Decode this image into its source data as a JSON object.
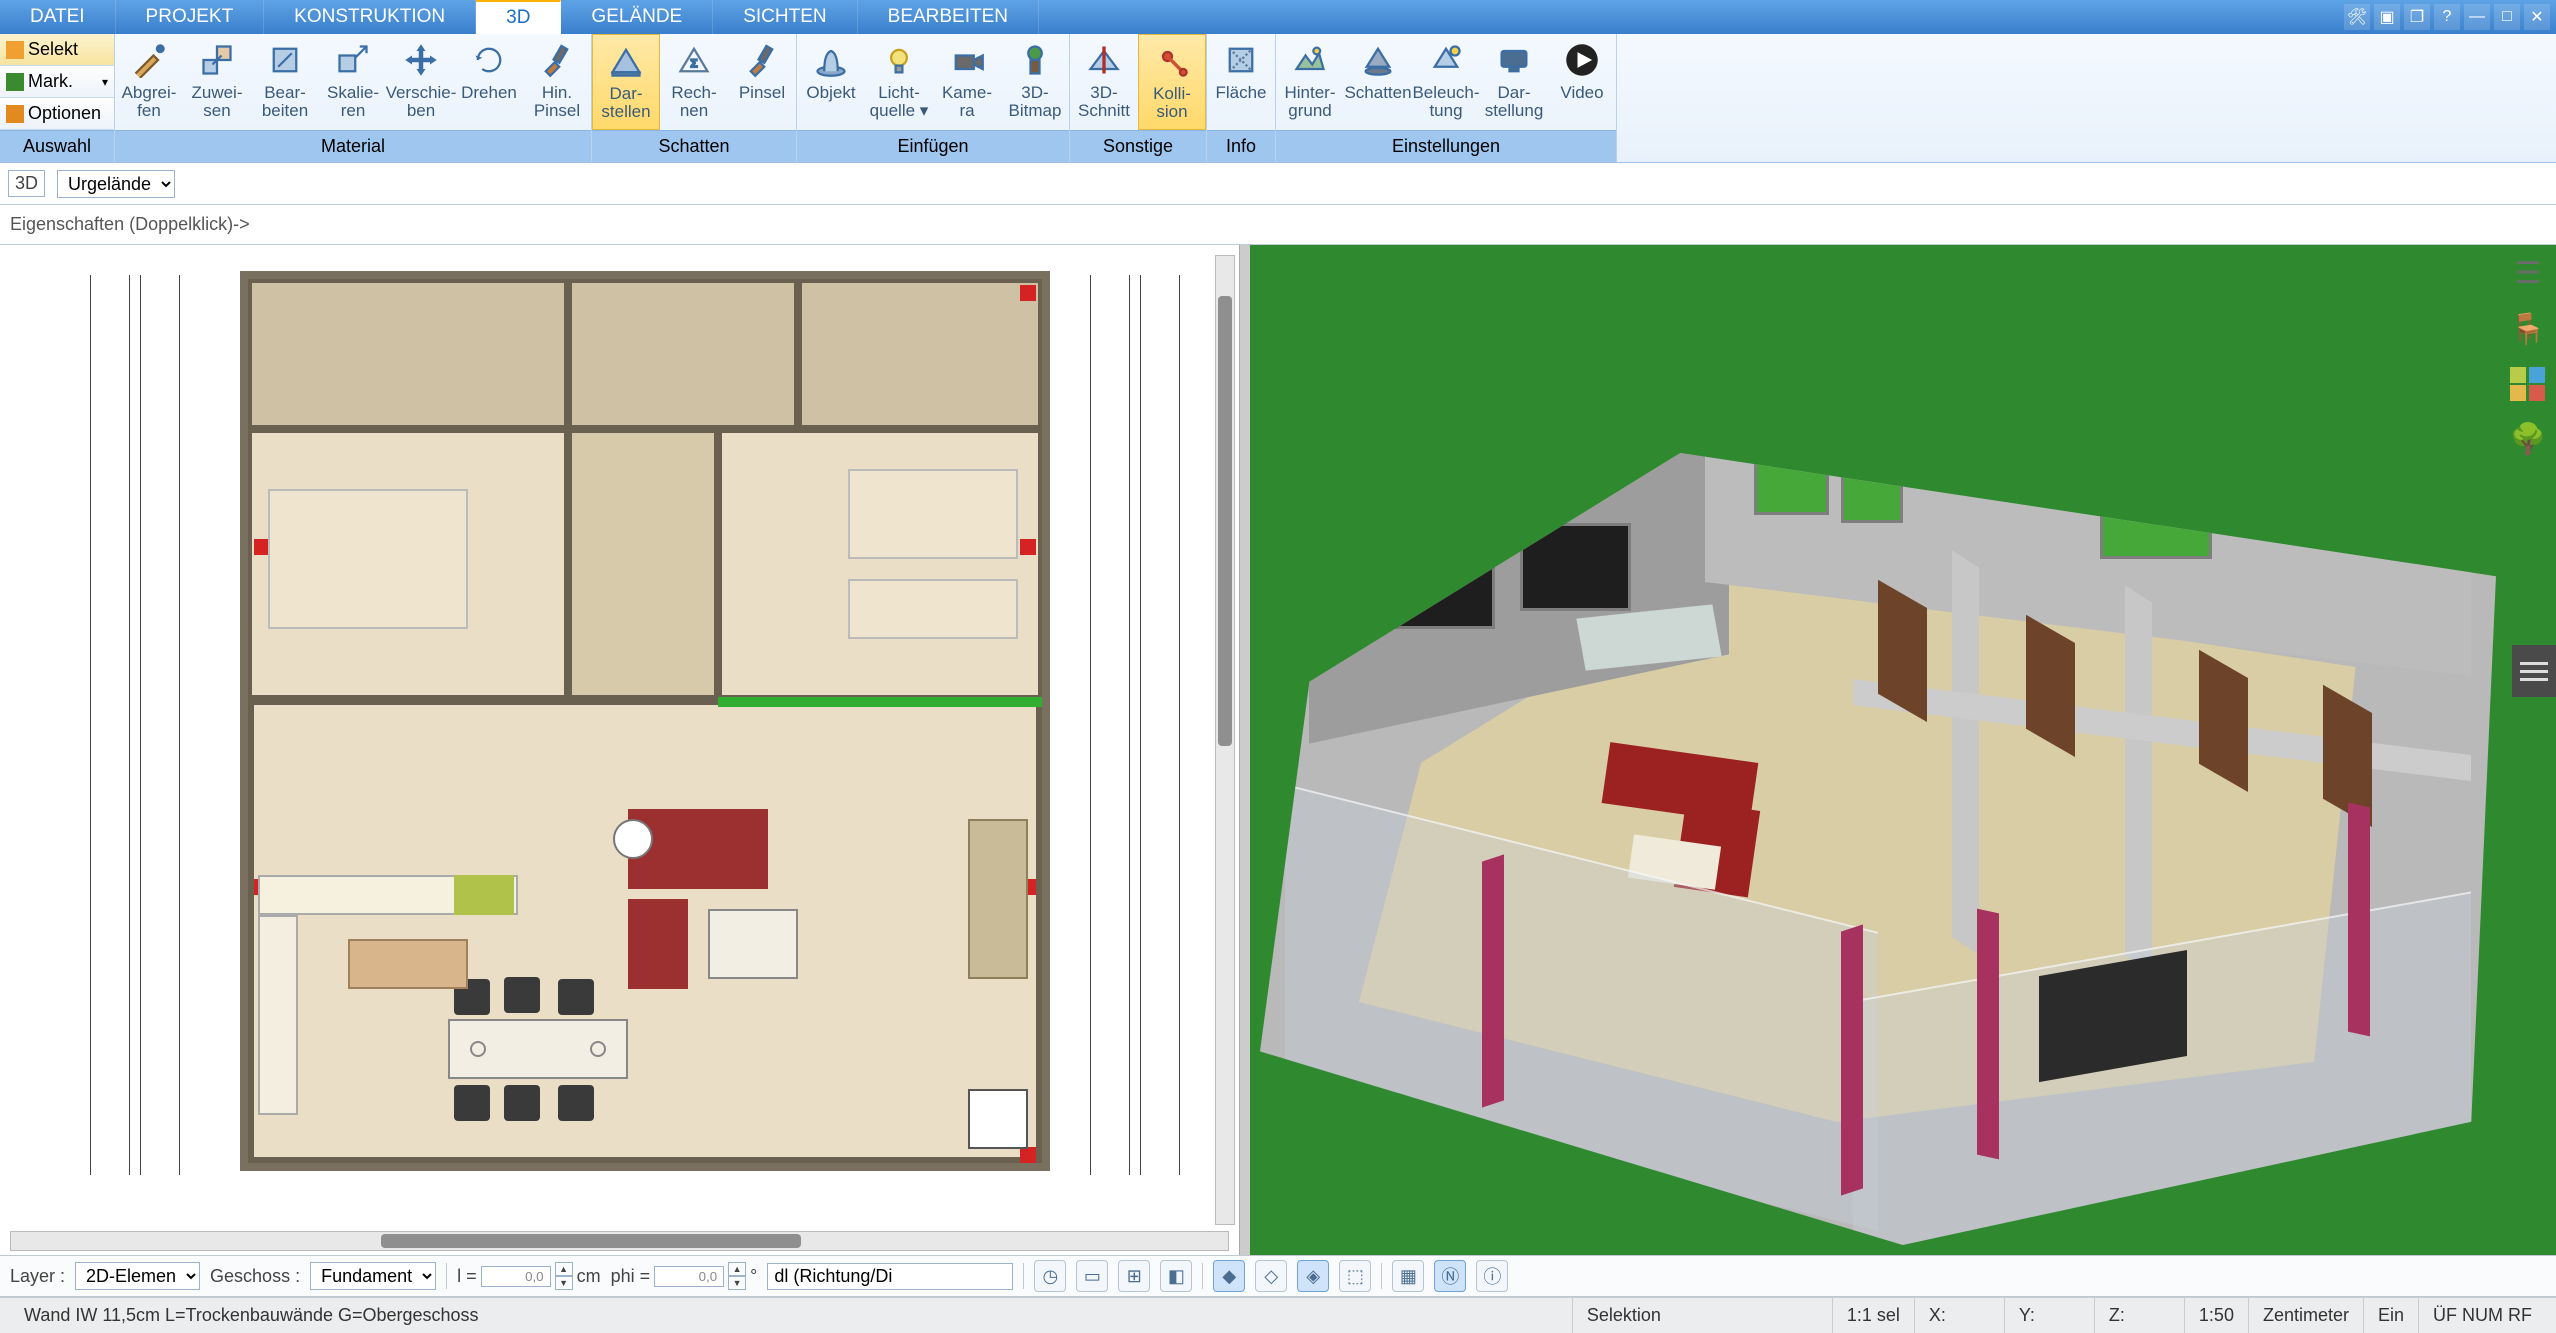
{
  "menu": {
    "tabs": [
      "DATEI",
      "PROJEKT",
      "KONSTRUKTION",
      "3D",
      "GELÄNDE",
      "SICHTEN",
      "BEARBEITEN"
    ],
    "active": "3D"
  },
  "side_buttons": {
    "select": "Selekt",
    "mark": "Mark.",
    "options": "Optionen",
    "group": "Auswahl"
  },
  "ribbon_groups": [
    {
      "label": "Material",
      "buttons": [
        {
          "key": "abgreifen",
          "label1": "Abgrei-",
          "label2": "fen"
        },
        {
          "key": "zuweisen",
          "label1": "Zuwei-",
          "label2": "sen"
        },
        {
          "key": "bearbeiten",
          "label1": "Bear-",
          "label2": "beiten"
        },
        {
          "key": "skalieren",
          "label1": "Skalie-",
          "label2": "ren"
        },
        {
          "key": "verschieben",
          "label1": "Verschie-",
          "label2": "ben"
        },
        {
          "key": "drehen",
          "label1": "Drehen",
          "label2": ""
        },
        {
          "key": "hinpinsel",
          "label1": "Hin.",
          "label2": "Pinsel"
        }
      ]
    },
    {
      "label": "Schatten",
      "buttons": [
        {
          "key": "darstellen",
          "label1": "Dar-",
          "label2": "stellen",
          "active": true
        },
        {
          "key": "rechnen",
          "label1": "Rech-",
          "label2": "nen"
        },
        {
          "key": "pinsel",
          "label1": "Pinsel",
          "label2": ""
        }
      ]
    },
    {
      "label": "Einfügen",
      "buttons": [
        {
          "key": "objekt",
          "label1": "Objekt",
          "label2": ""
        },
        {
          "key": "lichtquelle",
          "label1": "Licht-",
          "label2": "quelle ▾"
        },
        {
          "key": "kamera",
          "label1": "Kame-",
          "label2": "ra"
        },
        {
          "key": "bitmap3d",
          "label1": "3D-",
          "label2": "Bitmap"
        }
      ]
    },
    {
      "label": "Sonstige",
      "buttons": [
        {
          "key": "schnitt3d",
          "label1": "3D-",
          "label2": "Schnitt"
        },
        {
          "key": "kollision",
          "label1": "Kolli-",
          "label2": "sion",
          "active": true,
          "kolli": true
        }
      ]
    },
    {
      "label": "Info",
      "buttons": [
        {
          "key": "flaeche",
          "label1": "Fläche",
          "label2": ""
        }
      ]
    },
    {
      "label": "Einstellungen",
      "buttons": [
        {
          "key": "hintergrund",
          "label1": "Hinter-",
          "label2": "grund"
        },
        {
          "key": "schatten2",
          "label1": "Schatten",
          "label2": ""
        },
        {
          "key": "beleuchtung",
          "label1": "Beleuch-",
          "label2": "tung"
        },
        {
          "key": "darstellung",
          "label1": "Dar-",
          "label2": "stellung"
        },
        {
          "key": "video",
          "label1": "Video",
          "label2": "",
          "video": true
        }
      ]
    }
  ],
  "bar2": {
    "mode": "3D",
    "plane": "Urgelände"
  },
  "bar3": {
    "hint": "Eigenschaften (Doppelklick)->"
  },
  "bottombar": {
    "layer_label": "Layer :",
    "layer_value": "2D-Elemen",
    "geschoss_label": "Geschoss :",
    "geschoss_value": "Fundament",
    "l_label": "l =",
    "l_value": "0,0",
    "l_unit": "cm",
    "phi_label": "phi =",
    "phi_value": "0,0",
    "phi_unit": "°",
    "dl_value": "dl (Richtung/Di"
  },
  "status": {
    "hint": "Wand IW 11,5cm L=Trockenbauwände G=Obergeschoss",
    "selection": "Selektion",
    "sel_count": "1:1 sel",
    "x": "X:",
    "y": "Y:",
    "z": "Z:",
    "scale": "1:50",
    "unit": "Zentimeter",
    "on": "Ein",
    "flags": "ÜF  NUM  RF"
  }
}
